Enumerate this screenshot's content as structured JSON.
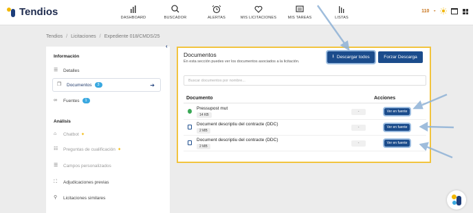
{
  "app": {
    "name": "Tendios"
  },
  "nav": [
    {
      "label": "DASHBOARD",
      "icon": "bar-chart-icon"
    },
    {
      "label": "BUSCADOR",
      "icon": "search-icon"
    },
    {
      "label": "ALERTAS",
      "icon": "alarm-clock-icon"
    },
    {
      "label": "MIS LICITACIONES",
      "icon": "heart-icon"
    },
    {
      "label": "MIS TAREAS",
      "icon": "tasks-icon"
    },
    {
      "label": "LISTAS",
      "icon": "list-bars-icon"
    }
  ],
  "header": {
    "coins": "110"
  },
  "breadcrumb": [
    "Tendios",
    "Licitaciones",
    "Expediente 018/CMDS/25"
  ],
  "sidebar": {
    "info_title": "Información",
    "items": [
      {
        "label": "Detalles",
        "icon": "list-icon"
      },
      {
        "label": "Documentos",
        "icon": "documents-icon",
        "badge": "3"
      },
      {
        "label": "Fuentes",
        "icon": "link-icon",
        "badge": "1"
      }
    ],
    "analysis_title": "Análisis",
    "analysis_items": [
      {
        "label": "Chatbot",
        "icon": "chatbot-icon"
      },
      {
        "label": "Preguntas de cualificación",
        "icon": "questions-icon"
      },
      {
        "label": "Campos personalizados",
        "icon": "fields-icon"
      },
      {
        "label": "Adjudicaciones previas",
        "icon": "awards-icon"
      },
      {
        "label": "Licitaciones similares",
        "icon": "similar-icon"
      }
    ]
  },
  "documents": {
    "title": "Documentos",
    "subtitle": "En esta sección puedes ver los documentos asociados a la licitación.",
    "download_all": "Descargar todos",
    "force_download": "Forzar Descarga",
    "search_placeholder": "Buscar documentos por nombre...",
    "col_document": "Documento",
    "col_actions": "Acciones",
    "rows": [
      {
        "name": "Pressupost mut",
        "size": "14 KB",
        "dash": "-",
        "action": "Ver en fuente"
      },
      {
        "name": "Document descriptiu del contracte (DDC)",
        "size": "2 MB",
        "dash": "-",
        "action": "Ver en fuente"
      },
      {
        "name": "Document descriptiu del contracte (DDC)",
        "size": "2 MB",
        "dash": "-",
        "action": "Ver en fuente"
      }
    ]
  },
  "colors": {
    "accent": "#1b4c8c",
    "highlight": "#f2c33c",
    "badge": "#39a8e0"
  }
}
